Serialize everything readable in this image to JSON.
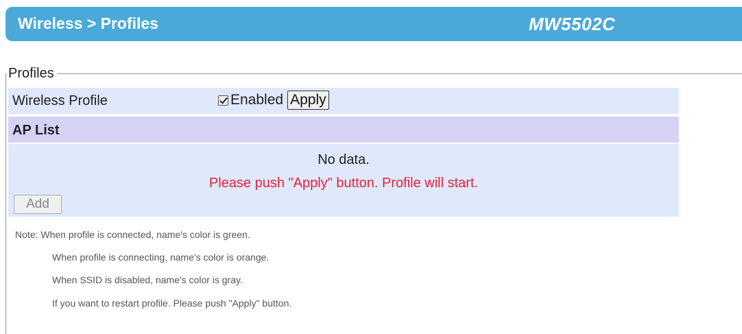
{
  "header": {
    "breadcrumb": "Wireless > Profiles",
    "model": "MW5502C",
    "background_color": "#4aa9d8"
  },
  "profiles": {
    "legend": "Profiles",
    "wireless_profile": {
      "label": "Wireless Profile",
      "checkbox_checked": true,
      "checkbox_label": "Enabled",
      "apply_label": "Apply"
    },
    "ap_list": {
      "title": "AP List",
      "empty_text": "No data.",
      "push_message": "Please push \"Apply\" button. Profile will start.",
      "push_message_color": "#e8203a",
      "add_label": "Add"
    }
  },
  "notes": [
    "Note: When profile is connected, name's color is green.",
    "When profile is connecting, name's color is orange.",
    "When SSID is disabled, name's color is gray.",
    "If you want to restart profile. Please push \"Apply\" button."
  ]
}
